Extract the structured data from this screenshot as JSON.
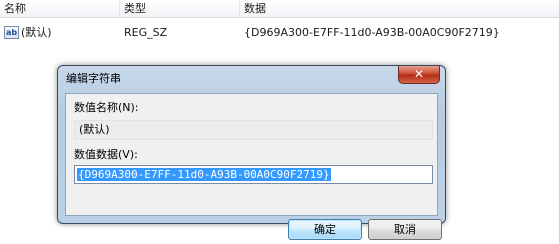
{
  "list": {
    "columns": {
      "name": "名称",
      "type": "类型",
      "data": "数据"
    },
    "rows": [
      {
        "icon": "string-value-icon",
        "icon_text": "ab",
        "name": "(默认)",
        "type": "REG_SZ",
        "data": "{D969A300-E7FF-11d0-A93B-00A0C90F2719}"
      }
    ]
  },
  "dialog": {
    "title": "编辑字符串",
    "close_glyph": "✕",
    "value_name_label": "数值名称(N):",
    "value_name": "(默认)",
    "value_data_label": "数值数据(V):",
    "value_data": "{D969A300-E7FF-11d0-A93B-00A0C90F2719}",
    "value_data_selected": true,
    "ok_label": "确定",
    "cancel_label": "取消"
  },
  "colors": {
    "selection": "#3399ff",
    "dialog_frame": "#bcd0e6",
    "close_button": "#c7432a"
  }
}
